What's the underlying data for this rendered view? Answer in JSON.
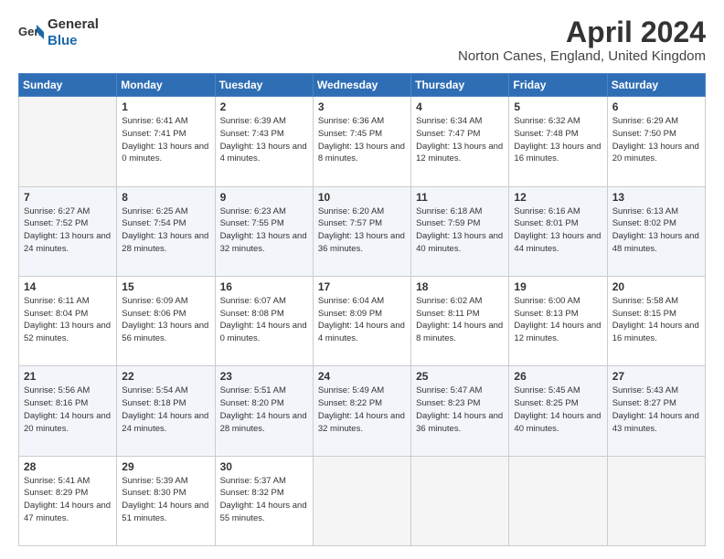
{
  "logo": {
    "general": "General",
    "blue": "Blue"
  },
  "title": "April 2024",
  "subtitle": "Norton Canes, England, United Kingdom",
  "headers": [
    "Sunday",
    "Monday",
    "Tuesday",
    "Wednesday",
    "Thursday",
    "Friday",
    "Saturday"
  ],
  "weeks": [
    [
      {
        "day": "",
        "sunrise": "",
        "sunset": "",
        "daylight": ""
      },
      {
        "day": "1",
        "sunrise": "Sunrise: 6:41 AM",
        "sunset": "Sunset: 7:41 PM",
        "daylight": "Daylight: 13 hours and 0 minutes."
      },
      {
        "day": "2",
        "sunrise": "Sunrise: 6:39 AM",
        "sunset": "Sunset: 7:43 PM",
        "daylight": "Daylight: 13 hours and 4 minutes."
      },
      {
        "day": "3",
        "sunrise": "Sunrise: 6:36 AM",
        "sunset": "Sunset: 7:45 PM",
        "daylight": "Daylight: 13 hours and 8 minutes."
      },
      {
        "day": "4",
        "sunrise": "Sunrise: 6:34 AM",
        "sunset": "Sunset: 7:47 PM",
        "daylight": "Daylight: 13 hours and 12 minutes."
      },
      {
        "day": "5",
        "sunrise": "Sunrise: 6:32 AM",
        "sunset": "Sunset: 7:48 PM",
        "daylight": "Daylight: 13 hours and 16 minutes."
      },
      {
        "day": "6",
        "sunrise": "Sunrise: 6:29 AM",
        "sunset": "Sunset: 7:50 PM",
        "daylight": "Daylight: 13 hours and 20 minutes."
      }
    ],
    [
      {
        "day": "7",
        "sunrise": "Sunrise: 6:27 AM",
        "sunset": "Sunset: 7:52 PM",
        "daylight": "Daylight: 13 hours and 24 minutes."
      },
      {
        "day": "8",
        "sunrise": "Sunrise: 6:25 AM",
        "sunset": "Sunset: 7:54 PM",
        "daylight": "Daylight: 13 hours and 28 minutes."
      },
      {
        "day": "9",
        "sunrise": "Sunrise: 6:23 AM",
        "sunset": "Sunset: 7:55 PM",
        "daylight": "Daylight: 13 hours and 32 minutes."
      },
      {
        "day": "10",
        "sunrise": "Sunrise: 6:20 AM",
        "sunset": "Sunset: 7:57 PM",
        "daylight": "Daylight: 13 hours and 36 minutes."
      },
      {
        "day": "11",
        "sunrise": "Sunrise: 6:18 AM",
        "sunset": "Sunset: 7:59 PM",
        "daylight": "Daylight: 13 hours and 40 minutes."
      },
      {
        "day": "12",
        "sunrise": "Sunrise: 6:16 AM",
        "sunset": "Sunset: 8:01 PM",
        "daylight": "Daylight: 13 hours and 44 minutes."
      },
      {
        "day": "13",
        "sunrise": "Sunrise: 6:13 AM",
        "sunset": "Sunset: 8:02 PM",
        "daylight": "Daylight: 13 hours and 48 minutes."
      }
    ],
    [
      {
        "day": "14",
        "sunrise": "Sunrise: 6:11 AM",
        "sunset": "Sunset: 8:04 PM",
        "daylight": "Daylight: 13 hours and 52 minutes."
      },
      {
        "day": "15",
        "sunrise": "Sunrise: 6:09 AM",
        "sunset": "Sunset: 8:06 PM",
        "daylight": "Daylight: 13 hours and 56 minutes."
      },
      {
        "day": "16",
        "sunrise": "Sunrise: 6:07 AM",
        "sunset": "Sunset: 8:08 PM",
        "daylight": "Daylight: 14 hours and 0 minutes."
      },
      {
        "day": "17",
        "sunrise": "Sunrise: 6:04 AM",
        "sunset": "Sunset: 8:09 PM",
        "daylight": "Daylight: 14 hours and 4 minutes."
      },
      {
        "day": "18",
        "sunrise": "Sunrise: 6:02 AM",
        "sunset": "Sunset: 8:11 PM",
        "daylight": "Daylight: 14 hours and 8 minutes."
      },
      {
        "day": "19",
        "sunrise": "Sunrise: 6:00 AM",
        "sunset": "Sunset: 8:13 PM",
        "daylight": "Daylight: 14 hours and 12 minutes."
      },
      {
        "day": "20",
        "sunrise": "Sunrise: 5:58 AM",
        "sunset": "Sunset: 8:15 PM",
        "daylight": "Daylight: 14 hours and 16 minutes."
      }
    ],
    [
      {
        "day": "21",
        "sunrise": "Sunrise: 5:56 AM",
        "sunset": "Sunset: 8:16 PM",
        "daylight": "Daylight: 14 hours and 20 minutes."
      },
      {
        "day": "22",
        "sunrise": "Sunrise: 5:54 AM",
        "sunset": "Sunset: 8:18 PM",
        "daylight": "Daylight: 14 hours and 24 minutes."
      },
      {
        "day": "23",
        "sunrise": "Sunrise: 5:51 AM",
        "sunset": "Sunset: 8:20 PM",
        "daylight": "Daylight: 14 hours and 28 minutes."
      },
      {
        "day": "24",
        "sunrise": "Sunrise: 5:49 AM",
        "sunset": "Sunset: 8:22 PM",
        "daylight": "Daylight: 14 hours and 32 minutes."
      },
      {
        "day": "25",
        "sunrise": "Sunrise: 5:47 AM",
        "sunset": "Sunset: 8:23 PM",
        "daylight": "Daylight: 14 hours and 36 minutes."
      },
      {
        "day": "26",
        "sunrise": "Sunrise: 5:45 AM",
        "sunset": "Sunset: 8:25 PM",
        "daylight": "Daylight: 14 hours and 40 minutes."
      },
      {
        "day": "27",
        "sunrise": "Sunrise: 5:43 AM",
        "sunset": "Sunset: 8:27 PM",
        "daylight": "Daylight: 14 hours and 43 minutes."
      }
    ],
    [
      {
        "day": "28",
        "sunrise": "Sunrise: 5:41 AM",
        "sunset": "Sunset: 8:29 PM",
        "daylight": "Daylight: 14 hours and 47 minutes."
      },
      {
        "day": "29",
        "sunrise": "Sunrise: 5:39 AM",
        "sunset": "Sunset: 8:30 PM",
        "daylight": "Daylight: 14 hours and 51 minutes."
      },
      {
        "day": "30",
        "sunrise": "Sunrise: 5:37 AM",
        "sunset": "Sunset: 8:32 PM",
        "daylight": "Daylight: 14 hours and 55 minutes."
      },
      {
        "day": "",
        "sunrise": "",
        "sunset": "",
        "daylight": ""
      },
      {
        "day": "",
        "sunrise": "",
        "sunset": "",
        "daylight": ""
      },
      {
        "day": "",
        "sunrise": "",
        "sunset": "",
        "daylight": ""
      },
      {
        "day": "",
        "sunrise": "",
        "sunset": "",
        "daylight": ""
      }
    ]
  ]
}
